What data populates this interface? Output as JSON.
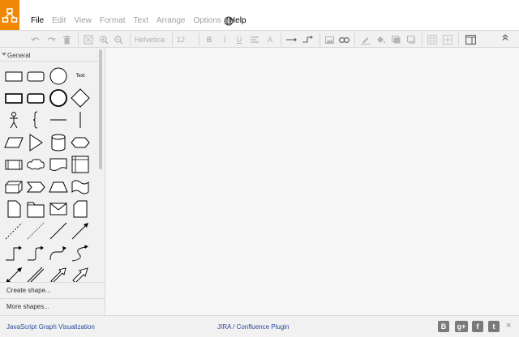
{
  "menu": [
    {
      "label": "File",
      "enabled": true
    },
    {
      "label": "Edit",
      "enabled": false
    },
    {
      "label": "View",
      "enabled": false
    },
    {
      "label": "Format",
      "enabled": false
    },
    {
      "label": "Text",
      "enabled": false
    },
    {
      "label": "Arrange",
      "enabled": false
    },
    {
      "label": "Options",
      "enabled": false
    },
    {
      "label": "Help",
      "enabled": true
    }
  ],
  "toolbar": {
    "font_name": "Helvetica",
    "font_size": "12",
    "bold": "B",
    "italic": "I",
    "underline": "U",
    "font_color": "A"
  },
  "sidebar": {
    "section_title": "General",
    "text_shape_label": "Text",
    "create_shape": "Create shape...",
    "more_shapes": "More shapes..."
  },
  "footer": {
    "left_link": "JavaScript Graph Visualization",
    "center_link": "JIRA / Confluence Plugin",
    "close": "×"
  },
  "colors": {
    "brand": "#f08705",
    "link": "#2a4a9c"
  }
}
